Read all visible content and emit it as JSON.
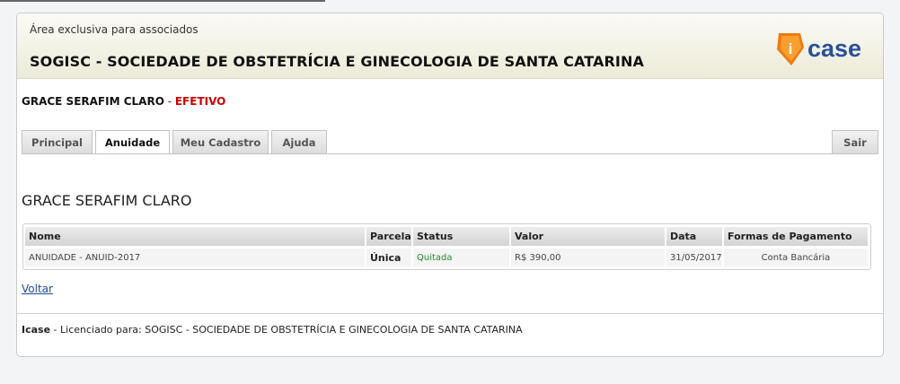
{
  "header": {
    "area_label": "Área exclusiva para associados",
    "org_title": "SOGISC - SOCIEDADE DE OBSTETRÍCIA E GINECOLOGIA DE SANTA CATARINA",
    "logo_text": "case",
    "logo_letter": "i"
  },
  "user": {
    "name": "GRACE SERAFIM CLARO",
    "separator": " - ",
    "role": "EFETIVO"
  },
  "tabs": [
    {
      "label": "Principal"
    },
    {
      "label": "Anuidade"
    },
    {
      "label": "Meu Cadastro"
    },
    {
      "label": "Ajuda"
    }
  ],
  "active_tab": "Anuidade",
  "exit_label": "Sair",
  "page_heading": "GRACE SERAFIM CLARO",
  "table": {
    "headers": [
      "Nome",
      "Parcela",
      "Status",
      "Valor",
      "Data",
      "Formas de Pagamento"
    ],
    "rows": [
      [
        "ANUIDADE - ANUID-2017",
        "Única",
        "Quitada",
        "R$ 390,00",
        "31/05/2017",
        "Conta Bancária"
      ]
    ]
  },
  "back_link": "Voltar",
  "footer": {
    "brand": "Icase",
    "text": " - Licenciado para: SOGISC - SOCIEDADE DE OBSTETRÍCIA E GINECOLOGIA DE SANTA CATARINA"
  },
  "colors": {
    "role": "#cc0000",
    "status_paid": "#2a8a2a",
    "link": "#1a4a9c",
    "logo_orange": "#f07a10",
    "logo_blue": "#2a4f9a"
  }
}
